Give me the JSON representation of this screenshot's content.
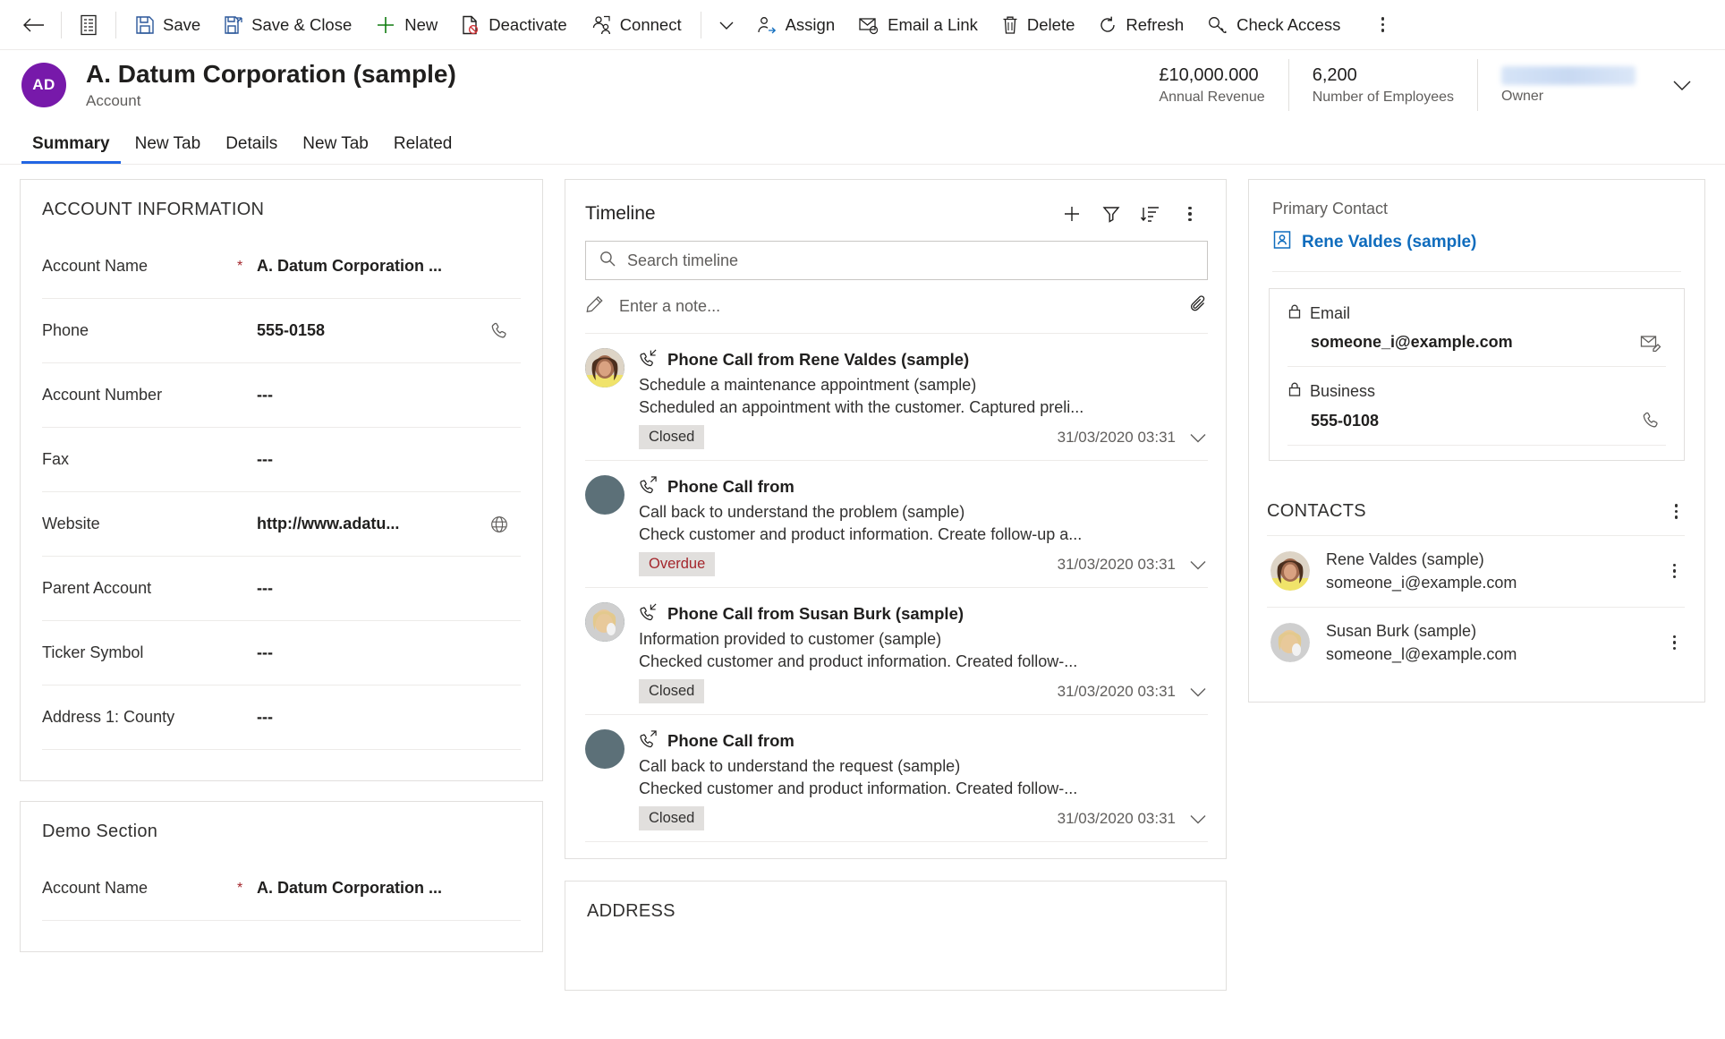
{
  "commandbar": {
    "back_icon": "back-arrow-icon",
    "form_selector_icon": "form-list-icon",
    "buttons": [
      {
        "label": "Save",
        "icon": "save-icon"
      },
      {
        "label": "Save & Close",
        "icon": "save-close-icon"
      },
      {
        "label": "New",
        "icon": "plus-icon"
      },
      {
        "label": "Deactivate",
        "icon": "deactivate-icon"
      },
      {
        "label": "Connect",
        "icon": "connect-icon"
      }
    ],
    "connect_chevron_icon": "chevron-down-icon",
    "buttons2": [
      {
        "label": "Assign",
        "icon": "assign-icon"
      },
      {
        "label": "Email a Link",
        "icon": "email-link-icon"
      },
      {
        "label": "Delete",
        "icon": "trash-icon"
      },
      {
        "label": "Refresh",
        "icon": "refresh-icon"
      },
      {
        "label": "Check Access",
        "icon": "key-icon"
      }
    ],
    "overflow_icon": "more-vertical-icon"
  },
  "header": {
    "avatar_initials": "AD",
    "title": "A. Datum Corporation (sample)",
    "subtitle": "Account",
    "stats": [
      {
        "value": "£10,000.000",
        "label": "Annual Revenue"
      },
      {
        "value": "6,200",
        "label": "Number of Employees"
      },
      {
        "value": "",
        "label": "Owner",
        "redacted": true
      }
    ],
    "chevron_icon": "chevron-down-icon"
  },
  "tabs": [
    {
      "label": "Summary",
      "active": true
    },
    {
      "label": "New Tab",
      "active": false
    },
    {
      "label": "Details",
      "active": false
    },
    {
      "label": "New Tab",
      "active": false
    },
    {
      "label": "Related",
      "active": false
    }
  ],
  "account_information": {
    "title": "ACCOUNT INFORMATION",
    "fields": [
      {
        "label": "Account Name",
        "required": true,
        "value": "A. Datum Corporation ...",
        "action_icon": ""
      },
      {
        "label": "Phone",
        "required": false,
        "value": "555-0158",
        "action_icon": "phone-icon"
      },
      {
        "label": "Account Number",
        "required": false,
        "value": "---",
        "action_icon": ""
      },
      {
        "label": "Fax",
        "required": false,
        "value": "---",
        "action_icon": ""
      },
      {
        "label": "Website",
        "required": false,
        "value": "http://www.adatu...",
        "action_icon": "globe-icon"
      },
      {
        "label": "Parent Account",
        "required": false,
        "value": "---",
        "action_icon": ""
      },
      {
        "label": "Ticker Symbol",
        "required": false,
        "value": "---",
        "action_icon": ""
      },
      {
        "label": "Address 1: County",
        "required": false,
        "value": "---",
        "action_icon": ""
      }
    ]
  },
  "demo_section": {
    "title": "Demo Section",
    "fields": [
      {
        "label": "Account Name",
        "required": true,
        "value": "A. Datum Corporation ...",
        "action_icon": ""
      }
    ]
  },
  "timeline": {
    "title": "Timeline",
    "actions": [
      {
        "icon": "plus-icon",
        "name": "add-record"
      },
      {
        "icon": "filter-icon",
        "name": "filter"
      },
      {
        "icon": "sort-icon",
        "name": "sort"
      },
      {
        "icon": "more-vertical-icon",
        "name": "more-commands"
      }
    ],
    "search_placeholder": "Search timeline",
    "search_value": "",
    "search_icon": "search-icon",
    "note_placeholder": "Enter a note...",
    "note_value": "",
    "note_icon": "pencil-icon",
    "attach_icon": "paperclip-icon",
    "items": [
      {
        "title": "Phone Call from Rene Valdes (sample)",
        "subject": "Schedule a maintenance appointment (sample)",
        "description": "Scheduled an appointment with the customer. Captured preli...",
        "status": "Closed",
        "status_type": "closed",
        "timestamp": "31/03/2020 03:31",
        "call_icon": "phone-incoming-icon",
        "avatar": "photo-rene"
      },
      {
        "title": "Phone Call from",
        "subject": "Call back to understand the problem (sample)",
        "description": "Check customer and product information. Create follow-up a...",
        "status": "Overdue",
        "status_type": "overdue",
        "timestamp": "31/03/2020 03:31",
        "call_icon": "phone-outgoing-icon",
        "avatar": "placeholder"
      },
      {
        "title": "Phone Call from Susan Burk (sample)",
        "subject": "Information provided to customer (sample)",
        "description": "Checked customer and product information. Created follow-...",
        "status": "Closed",
        "status_type": "closed",
        "timestamp": "31/03/2020 03:31",
        "call_icon": "phone-incoming-icon",
        "avatar": "photo-susan"
      },
      {
        "title": "Phone Call from",
        "subject": "Call back to understand the request (sample)",
        "description": "Checked customer and product information. Created follow-...",
        "status": "Closed",
        "status_type": "closed",
        "timestamp": "31/03/2020 03:31",
        "call_icon": "phone-outgoing-icon",
        "avatar": "placeholder"
      }
    ]
  },
  "address_section": {
    "title": "ADDRESS"
  },
  "primary_contact": {
    "label": "Primary Contact",
    "name": "Rene Valdes (sample)",
    "name_icon": "contact-card-icon",
    "fields": [
      {
        "label": "Email",
        "lock_icon": "lock-icon",
        "value": "someone_i@example.com",
        "action_icon": "email-icon"
      },
      {
        "label": "Business",
        "lock_icon": "lock-icon",
        "value": "555-0108",
        "action_icon": "phone-icon"
      }
    ]
  },
  "contacts": {
    "title": "CONTACTS",
    "more_icon": "more-vertical-icon",
    "items": [
      {
        "name": "Rene Valdes (sample)",
        "email": "someone_i@example.com",
        "avatar": "photo-rene",
        "more_icon": "more-vertical-icon"
      },
      {
        "name": "Susan Burk (sample)",
        "email": "someone_l@example.com",
        "avatar": "photo-susan",
        "more_icon": "more-vertical-icon"
      }
    ]
  },
  "colors": {
    "accent": "#2266e3",
    "link": "#0f6cbd",
    "avatar_purple": "#7719aa",
    "required_red": "#a4262c",
    "overdue_red": "#a4262c",
    "save_blue": "#2b579a",
    "new_green": "#107c10"
  }
}
